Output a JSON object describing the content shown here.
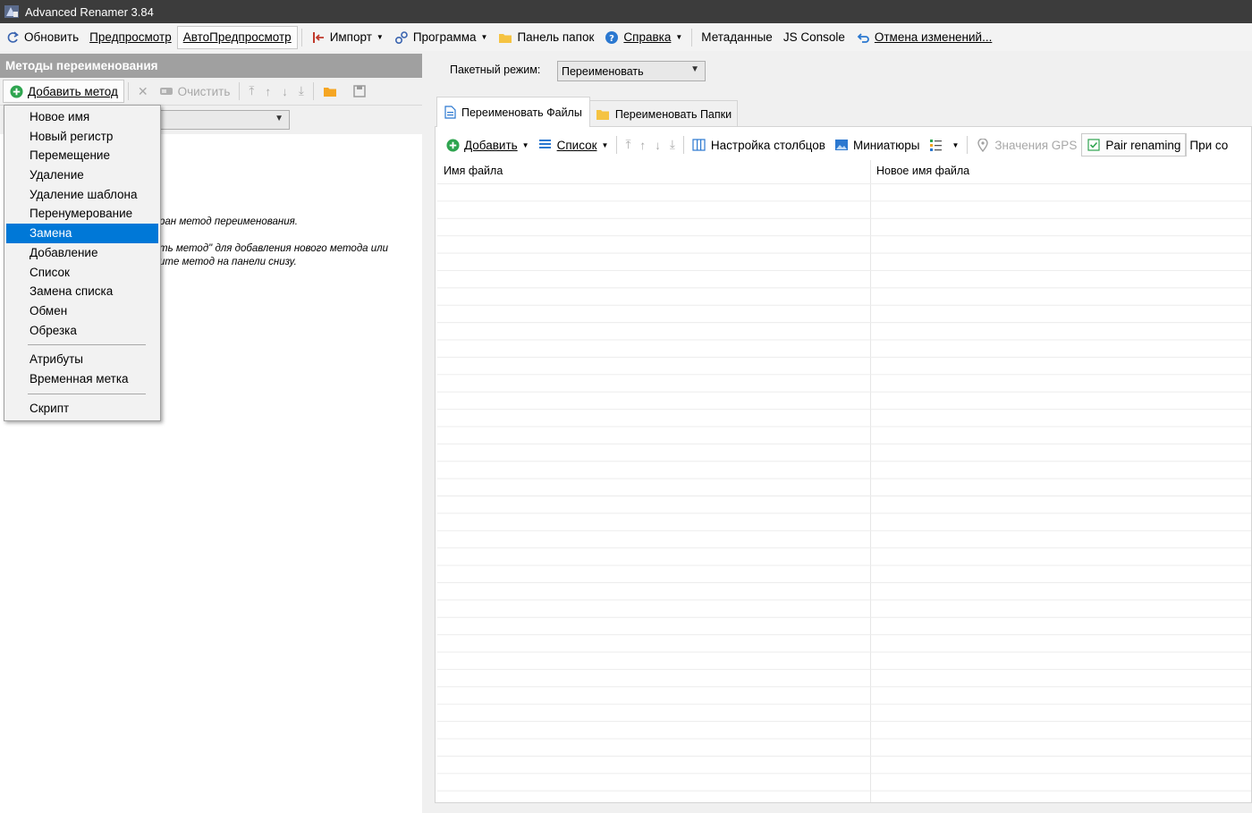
{
  "window": {
    "title": "Advanced Renamer 3.84"
  },
  "toolbar": {
    "refresh": "Обновить",
    "preview": "Предпросмотр",
    "auto_preview": "АвтоПредпросмотр",
    "import": "Импорт",
    "program": "Программа",
    "folder_panel": "Панель папок",
    "help": "Справка",
    "metadata": "Метаданные",
    "js_console": "JS Console",
    "undo": "Отмена изменений..."
  },
  "methods_panel": {
    "header": "Методы переименования",
    "add_method": "Добавить метод",
    "clear": "Очистить",
    "hint_line1": "ран метод переименования.",
    "hint_line2": "ть метод\" для добавления нового метода или",
    "hint_line3": "ите метод на панели снизу."
  },
  "method_menu": {
    "group1": [
      "Новое имя",
      "Новый регистр",
      "Перемещение",
      "Удаление",
      "Удаление шаблона",
      "Перенумерование",
      "Замена",
      "Добавление",
      "Список",
      "Замена списка",
      "Обмен",
      "Обрезка"
    ],
    "group2": [
      "Атрибуты",
      "Временная метка"
    ],
    "group3": [
      "Скрипт"
    ],
    "selected": "Замена"
  },
  "batch": {
    "label": "Пакетный режим:",
    "value": "Переименовать"
  },
  "tabs": {
    "files": "Переименовать Файлы",
    "folders": "Переименовать Папки"
  },
  "files_toolbar": {
    "add": "Добавить",
    "list": "Список",
    "columns": "Настройка столбцов",
    "thumbnails": "Миниатюры",
    "gps": "Значения GPS",
    "pair_renaming": "Pair renaming",
    "more": "При со"
  },
  "table": {
    "columns": [
      "Имя файла",
      "Новое имя файла"
    ]
  },
  "colors": {
    "title_bar": "#3c3c3c",
    "panel_header": "#a0a0a0",
    "selection": "#0078d7",
    "add_green": "#2ea44f"
  }
}
